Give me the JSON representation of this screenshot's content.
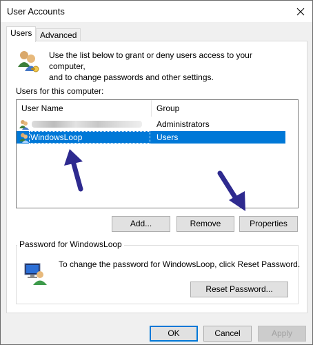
{
  "window": {
    "title": "User Accounts"
  },
  "tabs": [
    {
      "label": "Users",
      "active": true
    },
    {
      "label": "Advanced",
      "active": false
    }
  ],
  "intro": {
    "line1": "Use the list below to grant or deny users access to your computer,",
    "line2": "and to change passwords and other settings."
  },
  "users_list": {
    "label": "Users for this computer:",
    "columns": [
      "User Name",
      "Group"
    ],
    "rows": [
      {
        "name": "",
        "name_obscured": true,
        "group": "Administrators",
        "selected": false
      },
      {
        "name": "WindowsLoop",
        "group": "Users",
        "selected": true
      }
    ]
  },
  "list_buttons": {
    "add": "Add...",
    "remove": "Remove",
    "properties": "Properties"
  },
  "password_group": {
    "title": "Password for WindowsLoop",
    "text": "To change the password for WindowsLoop, click Reset Password.",
    "reset_button": "Reset Password..."
  },
  "dialog_buttons": {
    "ok": "OK",
    "cancel": "Cancel",
    "apply": "Apply",
    "apply_enabled": false
  },
  "colors": {
    "selection": "#0078d7",
    "annotation_arrow": "#2e2a8f"
  }
}
